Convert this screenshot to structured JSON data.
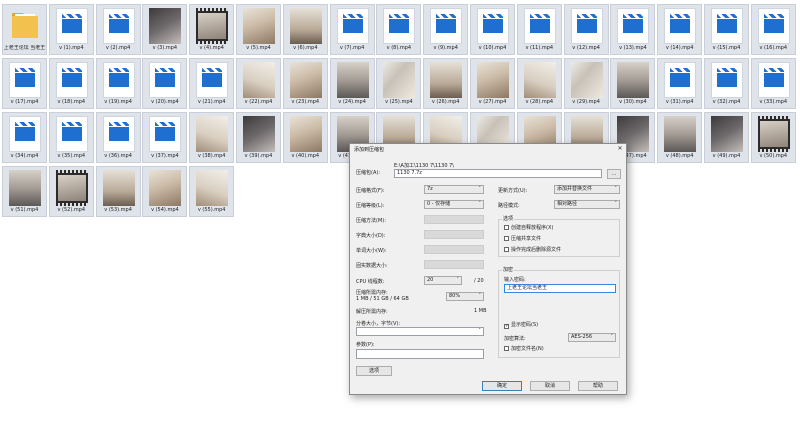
{
  "files": {
    "folder": {
      "label": "上老王论坛 当老王",
      "icon": "folder-icon"
    },
    "items": [
      {
        "label": "v (1).mp4",
        "kind": "video"
      },
      {
        "label": "v (2).mp4",
        "kind": "video"
      },
      {
        "label": "v (3).mp4",
        "kind": "photo",
        "tone": "c"
      },
      {
        "label": "v (4).mp4",
        "kind": "film"
      },
      {
        "label": "v (5).mp4",
        "kind": "photo",
        "tone": "a"
      },
      {
        "label": "v (6).mp4",
        "kind": "photo",
        "tone": "d"
      },
      {
        "label": "v (7).mp4",
        "kind": "video"
      },
      {
        "label": "v (8).mp4",
        "kind": "video"
      },
      {
        "label": "v (9).mp4",
        "kind": "video"
      },
      {
        "label": "v (10).mp4",
        "kind": "video"
      },
      {
        "label": "v (11).mp4",
        "kind": "video"
      },
      {
        "label": "v (12).mp4",
        "kind": "video"
      },
      {
        "label": "v (13).mp4",
        "kind": "video"
      },
      {
        "label": "v (14).mp4",
        "kind": "video"
      },
      {
        "label": "v (15).mp4",
        "kind": "video"
      },
      {
        "label": "v (16).mp4",
        "kind": "video"
      },
      {
        "label": "v (17).mp4",
        "kind": "video"
      },
      {
        "label": "v (18).mp4",
        "kind": "video"
      },
      {
        "label": "v (19).mp4",
        "kind": "video"
      },
      {
        "label": "v (20).mp4",
        "kind": "video"
      },
      {
        "label": "v (21).mp4",
        "kind": "video"
      },
      {
        "label": "v (22).mp4",
        "kind": "photo",
        "tone": "b"
      },
      {
        "label": "v (23).mp4",
        "kind": "photo",
        "tone": "a"
      },
      {
        "label": "v (24).mp4",
        "kind": "photo",
        "tone": "e"
      },
      {
        "label": "v (25).mp4",
        "kind": "photo",
        "tone": "f"
      },
      {
        "label": "v (26).mp4",
        "kind": "photo",
        "tone": "d"
      },
      {
        "label": "v (27).mp4",
        "kind": "photo",
        "tone": "a"
      },
      {
        "label": "v (28).mp4",
        "kind": "photo",
        "tone": "b"
      },
      {
        "label": "v (29).mp4",
        "kind": "photo",
        "tone": "f"
      },
      {
        "label": "v (30).mp4",
        "kind": "photo",
        "tone": "e"
      },
      {
        "label": "v (31).mp4",
        "kind": "video"
      },
      {
        "label": "v (32).mp4",
        "kind": "video"
      },
      {
        "label": "v (33).mp4",
        "kind": "video"
      },
      {
        "label": "v (34).mp4",
        "kind": "video"
      },
      {
        "label": "v (35).mp4",
        "kind": "video"
      },
      {
        "label": "v (36).mp4",
        "kind": "video"
      },
      {
        "label": "v (37).mp4",
        "kind": "video"
      },
      {
        "label": "v (38).mp4",
        "kind": "photo",
        "tone": "b"
      },
      {
        "label": "v (39).mp4",
        "kind": "photo",
        "tone": "c"
      },
      {
        "label": "v (40).mp4",
        "kind": "photo",
        "tone": "a"
      },
      {
        "label": "v (41).mp4",
        "kind": "photo",
        "tone": "e"
      },
      {
        "label": "v (42).mp4",
        "kind": "photo",
        "tone": "d"
      },
      {
        "label": "v (43).mp4",
        "kind": "photo",
        "tone": "b"
      },
      {
        "label": "v (44).mp4",
        "kind": "photo",
        "tone": "f"
      },
      {
        "label": "v (45).mp4",
        "kind": "photo",
        "tone": "a"
      },
      {
        "label": "v (46).mp4",
        "kind": "photo",
        "tone": "d"
      },
      {
        "label": "v (47).mp4",
        "kind": "photo",
        "tone": "c"
      },
      {
        "label": "v (48).mp4",
        "kind": "photo",
        "tone": "e"
      },
      {
        "label": "v (49).mp4",
        "kind": "photo",
        "tone": "c"
      },
      {
        "label": "v (50).mp4",
        "kind": "film"
      },
      {
        "label": "v (51).mp4",
        "kind": "photo",
        "tone": "e"
      },
      {
        "label": "v (52).mp4",
        "kind": "film"
      },
      {
        "label": "v (53).mp4",
        "kind": "photo",
        "tone": "d"
      },
      {
        "label": "v (54).mp4",
        "kind": "photo",
        "tone": "a"
      },
      {
        "label": "v (55).mp4",
        "kind": "photo",
        "tone": "b"
      }
    ]
  },
  "dialog": {
    "title": "添加到压缩包",
    "archive_label": "压缩包(A):",
    "archive_path": "E:\\A加工\\1130 7\\1130 7\\",
    "archive_name": "1130 7.7z",
    "browse_label": "...",
    "format_label": "压缩格式(F):",
    "format_value": "7z",
    "level_label": "压缩等级(L):",
    "level_value": "0 - 仅存储",
    "method_label": "压缩方法(M):",
    "dict_label": "字典大小(D):",
    "word_label": "单词大小(W):",
    "solid_label": "固实数据大小:",
    "cpu_label": "CPU 线程数:",
    "cpu_value": "20",
    "cpu_total": "/ 20",
    "mem_label": "压缩所需内存:",
    "mem_detail": "1 MB / 51 GB / 64 GB",
    "mem_percent": "80%",
    "decomp_label": "解压所需内存:",
    "decomp_value": "1 MB",
    "split_label": "分卷大小，字节(V):",
    "params_label": "参数(P):",
    "options_btn": "选项",
    "update_label": "更新方式(U):",
    "update_value": "添加并替换文件",
    "path_label": "路径模式:",
    "path_value": "相对路径",
    "opts_title": "选项",
    "opt1": "创建自释放程序(X)",
    "opt2": "压缩共享文件",
    "opt3": "操作完成后删除源文件",
    "enc_title": "加密",
    "pw_label": "输入密码:",
    "pw_value": "上老王论坛当老王",
    "show_pw": "显示密码(S)",
    "enc_method_label": "加密算法:",
    "enc_method_value": "AES-256",
    "enc_names": "加密文件名(N)",
    "ok": "确定",
    "cancel": "取消",
    "help": "帮助"
  }
}
